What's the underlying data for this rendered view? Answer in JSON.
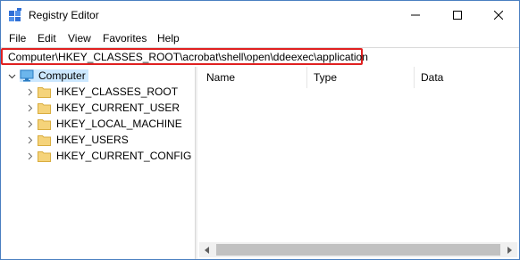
{
  "window": {
    "title": "Registry Editor"
  },
  "icons": {
    "app": "registry-editor-icon",
    "minimize": "minimize-icon",
    "maximize": "maximize-icon",
    "close": "close-icon",
    "folder": "folder-icon",
    "computer": "computer-icon",
    "expand": "chevron-right-icon",
    "collapse": "chevron-down-icon"
  },
  "colors": {
    "highlight_border": "#e02020",
    "selection": "#cce8ff",
    "folder": "#f5d37a"
  },
  "menu": [
    "File",
    "Edit",
    "View",
    "Favorites",
    "Help"
  ],
  "address": {
    "path": "Computer\\HKEY_CLASSES_ROOT\\acrobat\\shell\\open\\ddeexec\\application"
  },
  "tree": {
    "root": "Computer",
    "children": [
      "HKEY_CLASSES_ROOT",
      "HKEY_CURRENT_USER",
      "HKEY_LOCAL_MACHINE",
      "HKEY_USERS",
      "HKEY_CURRENT_CONFIG"
    ]
  },
  "list": {
    "columns": [
      "Name",
      "Type",
      "Data"
    ]
  }
}
